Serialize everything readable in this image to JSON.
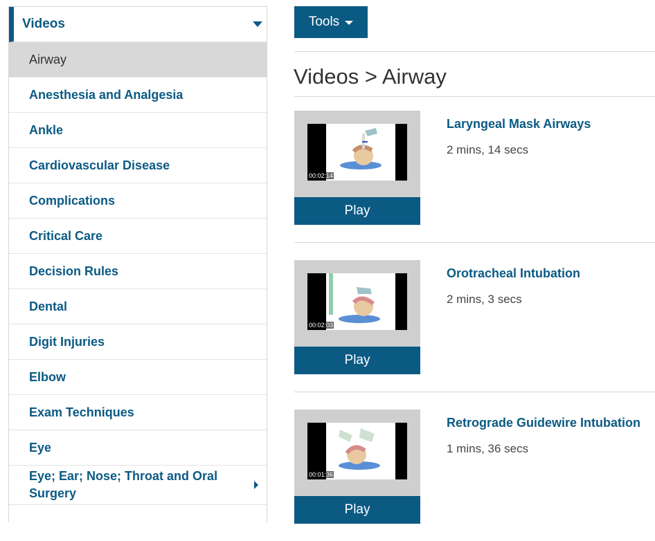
{
  "sidebar": {
    "header": "Videos",
    "items": [
      {
        "label": "Airway"
      },
      {
        "label": "Anesthesia and Analgesia"
      },
      {
        "label": "Ankle"
      },
      {
        "label": "Cardiovascular Disease"
      },
      {
        "label": "Complications"
      },
      {
        "label": "Critical Care"
      },
      {
        "label": "Decision Rules"
      },
      {
        "label": "Dental"
      },
      {
        "label": "Digit Injuries"
      },
      {
        "label": "Elbow"
      },
      {
        "label": "Exam Techniques"
      },
      {
        "label": "Eye"
      },
      {
        "label": "Eye; Ear; Nose; Throat and Oral Surgery"
      }
    ]
  },
  "toolbar": {
    "tools_label": "Tools"
  },
  "main": {
    "title": "Videos > Airway",
    "videos": [
      {
        "title": "Laryngeal Mask Airways",
        "duration": "2 mins, 14 secs",
        "timestamp": "00:02:14",
        "play_label": "Play"
      },
      {
        "title": "Orotracheal Intubation",
        "duration": "2 mins, 3 secs",
        "timestamp": "00:02:03",
        "play_label": "Play"
      },
      {
        "title": "Retrograde Guidewire Intubation",
        "duration": "1 mins, 36 secs",
        "timestamp": "00:01:36",
        "play_label": "Play"
      }
    ]
  },
  "colors": {
    "accent": "#0b5a84",
    "active_bg": "#d8d8d8",
    "thumb_bg": "#cfcfcf"
  }
}
